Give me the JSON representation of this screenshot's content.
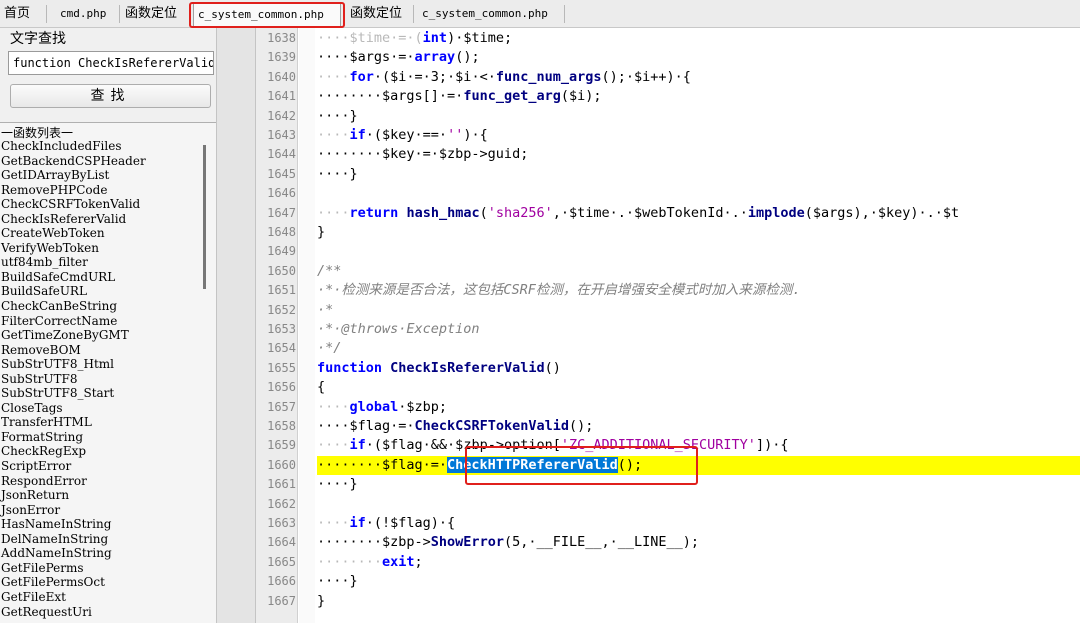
{
  "tabs": [
    {
      "label": "首页",
      "mono": false,
      "active": false
    },
    {
      "label": "cmd.php",
      "mono": true,
      "active": false
    },
    {
      "label": "函数定位",
      "mono": false,
      "active": false
    },
    {
      "label": "c_system_common.php",
      "mono": true,
      "active": true
    },
    {
      "label": "函数定位",
      "mono": false,
      "active": false
    },
    {
      "label": "c_system_common.php",
      "mono": true,
      "active": false
    }
  ],
  "search": {
    "title": "文字查找",
    "value": "function CheckIsRefererValid",
    "button_label": "查找"
  },
  "function_list": {
    "title": "一函数列表一",
    "items": [
      "CheckIncludedFiles",
      "GetBackendCSPHeader",
      "GetIDArrayByList",
      "RemovePHPCode",
      "CheckCSRFTokenValid",
      "CheckIsRefererValid",
      "CreateWebToken",
      "VerifyWebToken",
      "utf84mb_filter",
      "BuildSafeCmdURL",
      "BuildSafeURL",
      "CheckCanBeString",
      "FilterCorrectName",
      "GetTimeZoneByGMT",
      "RemoveBOM",
      "SubStrUTF8_Html",
      "SubStrUTF8",
      "SubStrUTF8_Start",
      "CloseTags",
      "TransferHTML",
      "FormatString",
      "CheckRegExp",
      "ScriptError",
      "RespondError",
      "JsonReturn",
      "JsonError",
      "HasNameInString",
      "DelNameInString",
      "AddNameInString",
      "GetFilePerms",
      "GetFilePermsOct",
      "GetFileExt",
      "GetRequestUri"
    ]
  },
  "editor": {
    "line_numbers": [
      "1638",
      "1639",
      "1640",
      "1641",
      "1642",
      "1643",
      "1644",
      "1645",
      "1646",
      "1647",
      "1648",
      "1649",
      "1650",
      "1651",
      "1652",
      "1653",
      "1654",
      "1655",
      "1656",
      "1657",
      "1658",
      "1659",
      "1660",
      "1661",
      "1662",
      "1663",
      "1664",
      "1665",
      "1666",
      "1667"
    ],
    "code": {
      "l1638_a": "····$time·=·(",
      "l1638_kw": "int",
      "l1638_b": ")·$time;",
      "l1639_a": "····$args·=·",
      "l1639_kw": "array",
      "l1639_b": "();",
      "l1640_kw": "for",
      "l1640_a": "·($i·=·3;·$i·<·",
      "l1640_fn": "func_num_args",
      "l1640_b": "();·$i++)·{",
      "l1641_a": "········$args[]·=·",
      "l1641_fn": "func_get_arg",
      "l1641_b": "($i);",
      "l1642": "····}",
      "l1643_kw": "if",
      "l1643_a": "·($key·==·",
      "l1643_str": "''",
      "l1643_b": ")·{",
      "l1644": "········$key·=·$zbp->guid;",
      "l1645": "····}",
      "l1646": "",
      "l1647_kw": "return",
      "l1647_fn": "hash_hmac",
      "l1647_a": "(",
      "l1647_str": "'sha256'",
      "l1647_b": ",·$time·.·$webTokenId·.·",
      "l1647_fn2": "implode",
      "l1647_c": "($args),·$key)·.·$t",
      "l1648": "}",
      "l1649": "",
      "l1650": "/**",
      "l1651": "·*·检测来源是否合法，这包括CSRF检测，在开启增强安全模式时加入来源检测.",
      "l1652": "·*",
      "l1653": "·*·@throws·Exception",
      "l1654": "·*/",
      "l1655_kw": "function",
      "l1655_fn": "CheckIsRefererValid",
      "l1655_a": "()",
      "l1656": "{",
      "l1657_kw": "global",
      "l1657_a": "·$zbp;",
      "l1658_a": "····$flag·=·",
      "l1658_fn": "CheckCSRFTokenValid",
      "l1658_b": "();",
      "l1659_kw": "if",
      "l1659_a": "·($flag·&&·$zbp->option[",
      "l1659_str": "'ZC_ADDITIONAL_SECURITY'",
      "l1659_b": "])·{",
      "l1660_a": "········$flag·=·",
      "l1660_sel": "CheckHTTPRefererValid",
      "l1660_b": "();",
      "l1661": "····}",
      "l1662": "",
      "l1663_kw": "if",
      "l1663_a": "·(!$flag)·{",
      "l1664_a": "········$zbp->",
      "l1664_fn": "ShowError",
      "l1664_b": "(5,·__FILE__,·__LINE__);",
      "l1665_kw": "exit",
      "l1665_a": ";",
      "l1666": "····}",
      "l1667": "}"
    },
    "colors": {
      "highlight_line": "#ffff00",
      "selection": "#0078d7",
      "keyword": "#0000ff",
      "string": "#a000a0",
      "comment": "#008000",
      "annotation_box": "#e0201c"
    }
  }
}
